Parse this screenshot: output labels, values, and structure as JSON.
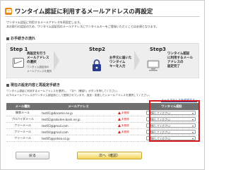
{
  "header": {
    "title": "ワンタイム認証に利用するメールアドレスの再設定",
    "icon": "mail-icon",
    "accent": "#e88a1a"
  },
  "intro": {
    "lines": [
      "ワンタイム認証に利用するメールアドレスを再設定します。",
      "本お取引の認証のため、ワンタイム認証用のメールアドレスにワンタイムキーをご登録いただくことは必須となります。"
    ]
  },
  "steps_section": {
    "title": "お手続きの流れ",
    "steps": [
      {
        "num": "Step 1",
        "desc": [
          "再設定を行う",
          "メールアドレス",
          "の選択"
        ],
        "note": [
          "ワンタイム認証用の",
          "メールアドレスを選択"
        ]
      },
      {
        "num": "Step2",
        "desc": [
          "お手元に届いた",
          "ワンタイム",
          "キーを入力"
        ],
        "note": []
      },
      {
        "num": "Step3",
        "desc": [
          "ワンタイム認証",
          "に利用するメール",
          "アドレスの",
          "設定完了"
        ],
        "note": []
      }
    ],
    "icons": [
      "mail-icon",
      "lock-icon",
      "computer-icon"
    ]
  },
  "current_section": {
    "title": "現在の設定内容と再設定手続き",
    "notes": [
      "ワンタイム認証に利用するメールアドレスを選択し、「次へ（確認）」ボタンを押してください。",
      "以下のメールアドレスがワンタイム認証用として登録されています。追加・変更したいメールアドレスを選択してください。"
    ],
    "link": "メールアドレスを追加する ›"
  },
  "table": {
    "headers": [
      "メール種別",
      "メールアドレス",
      "",
      "ワンタイム認証"
    ],
    "rows": [
      {
        "type": "携帯メール",
        "address": "test01@docomo.ne.jp",
        "status": "未登録",
        "warn": true,
        "select": "選択してください"
      },
      {
        "type": "プロバイダメール",
        "address": "test02@rakuten-bank.ne.jp",
        "status": "未登録",
        "warn": true,
        "select": "選択してください"
      },
      {
        "type": "フリーメール",
        "address": "test03@gmail.com",
        "status": "未登録",
        "warn": true,
        "select": "選択してください"
      },
      {
        "type": "フリーメール",
        "address": "test04@gmail.com",
        "status": "未登録",
        "warn": true,
        "select": "選択してください"
      },
      {
        "type": "フリーメール",
        "address": "test05@yahoo.co.jp",
        "status": "",
        "warn": false,
        "select": "選択してください"
      }
    ],
    "highlight_color": "#d91a1a"
  },
  "buttons": {
    "back": "戻る",
    "next": "次へ（確認）"
  }
}
